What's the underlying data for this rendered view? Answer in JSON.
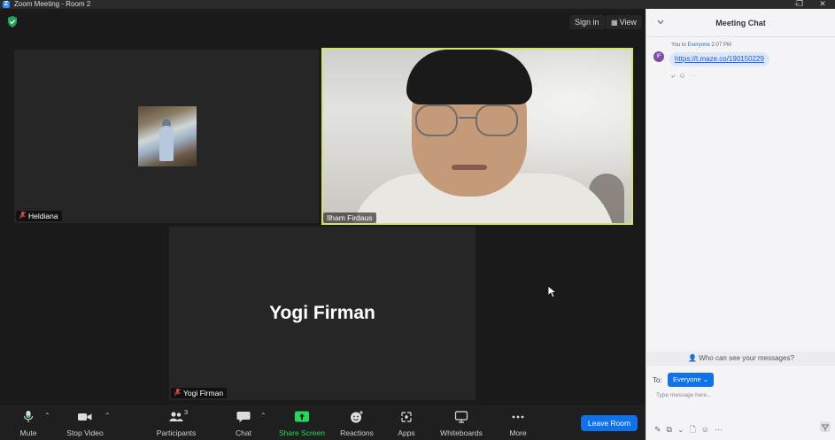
{
  "window": {
    "title": "Zoom Meeting - Room 2",
    "app_icon_letter": "Z",
    "minimize": "–",
    "maximize": "❐",
    "close": "✕"
  },
  "header": {
    "sign_in": "Sign in",
    "view": "View"
  },
  "participants_tiles": [
    {
      "name": "Heldiana",
      "type": "photo"
    },
    {
      "name": "Ilham Firdaus",
      "type": "video",
      "active_speaker": true
    },
    {
      "name": "Yogi Firman",
      "type": "name",
      "big_name": "Yogi Firman"
    }
  ],
  "toolbar": {
    "mute": "Mute",
    "stop_video": "Stop Video",
    "participants": "Participants",
    "participants_count": "3",
    "chat": "Chat",
    "share_screen": "Share Screen",
    "reactions": "Reactions",
    "apps": "Apps",
    "whiteboards": "Whiteboards",
    "more": "More",
    "leave": "Leave Room"
  },
  "chat": {
    "title": "Meeting Chat",
    "message": {
      "avatar_initials": "IF",
      "meta_you": "You to",
      "meta_to": "Everyone",
      "time": "2:07 PM",
      "text": "https://t.maze.co/190150229"
    },
    "privacy_note": "Who can see your messages?",
    "to_label": "To:",
    "recipient": "Everyone",
    "input_placeholder": "Type message here..."
  },
  "colors": {
    "accent_blue": "#0e72ed",
    "active_speaker_border": "#d6e36a",
    "share_green": "#23d959"
  }
}
